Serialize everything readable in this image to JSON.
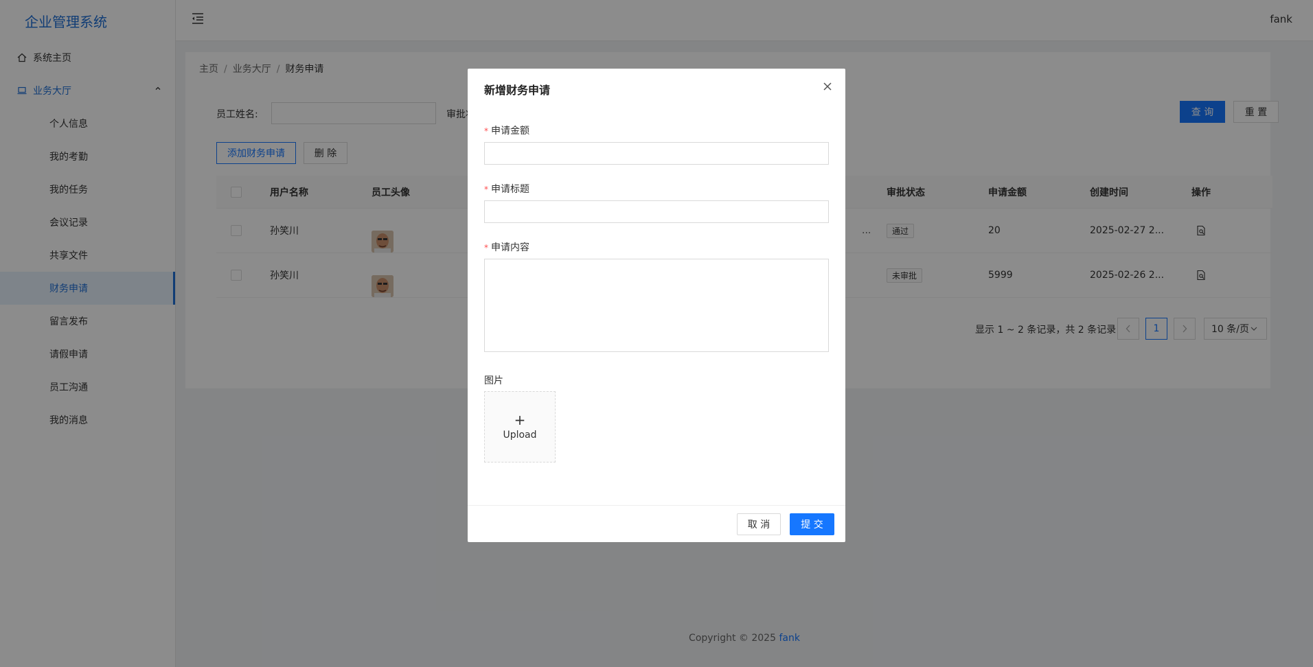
{
  "app": {
    "title": "企业管理系统",
    "user": "fank"
  },
  "sidebar": {
    "home": "系统主页",
    "hall": "业务大厅",
    "items": [
      {
        "label": "个人信息",
        "active": false
      },
      {
        "label": "我的考勤",
        "active": false
      },
      {
        "label": "我的任务",
        "active": false
      },
      {
        "label": "会议记录",
        "active": false
      },
      {
        "label": "共享文件",
        "active": false
      },
      {
        "label": "财务申请",
        "active": true
      },
      {
        "label": "留言发布",
        "active": false
      },
      {
        "label": "请假申请",
        "active": false
      },
      {
        "label": "员工沟通",
        "active": false
      },
      {
        "label": "我的消息",
        "active": false
      }
    ]
  },
  "breadcrumb": {
    "home": "主页",
    "hall": "业务大厅",
    "current": "财务申请"
  },
  "filter": {
    "name_label": "员工姓名:",
    "status_label": "审批状"
  },
  "toolbar": {
    "query": "查 询",
    "reset": "重 置",
    "add": "添加财务申请",
    "delete": "删 除"
  },
  "table": {
    "headers": {
      "username": "用户名称",
      "avatar": "员工头像",
      "status": "审批状态",
      "amount": "申请金额",
      "created": "创建时间",
      "action": "操作"
    },
    "rows": [
      {
        "username": "孙笑川",
        "status": "通过",
        "amount": "20",
        "created": "2025-02-27 2...",
        "trunc": "..."
      },
      {
        "username": "孙笑川",
        "status": "未审批",
        "amount": "5999",
        "created": "2025-02-26 2...",
        "trunc": ""
      }
    ]
  },
  "pagination": {
    "summary": "显示 1 ~ 2 条记录，共 2 条记录",
    "current": "1",
    "page_size": "10 条/页"
  },
  "footer": {
    "copyright": "Copyright © 2025",
    "author": "fank"
  },
  "modal": {
    "title": "新增财务申请",
    "amount_label": "申请金额",
    "title_label": "申请标题",
    "content_label": "申请内容",
    "image_label": "图片",
    "upload_text": "Upload",
    "cancel": "取 消",
    "submit": "提 交"
  }
}
